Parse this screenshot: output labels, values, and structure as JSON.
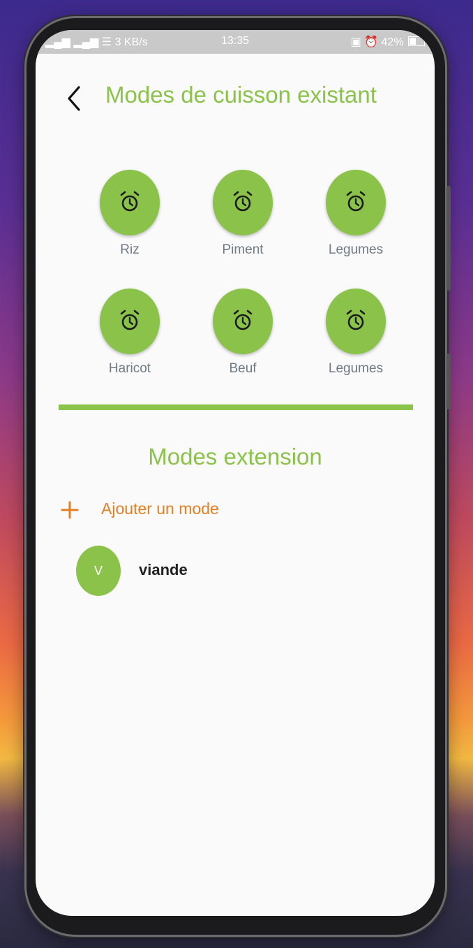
{
  "status_bar": {
    "signal": "▂▄▆ ▂▄▆ ☰ 3 KB/s",
    "time": "13:35",
    "battery": "42%"
  },
  "header": {
    "title": "Modes de cuisson existant",
    "back_icon": "chevron-left-icon"
  },
  "existing_modes": [
    {
      "label": "Riz",
      "icon": "alarm-clock-icon"
    },
    {
      "label": "Piment",
      "icon": "alarm-clock-icon"
    },
    {
      "label": "Legumes",
      "icon": "alarm-clock-icon"
    },
    {
      "label": "Haricot",
      "icon": "alarm-clock-icon"
    },
    {
      "label": "Beuf",
      "icon": "alarm-clock-icon"
    },
    {
      "label": "Legumes",
      "icon": "alarm-clock-icon"
    }
  ],
  "extension": {
    "title": "Modes extension",
    "add_label": "Ajouter un mode",
    "items": [
      {
        "initial": "V",
        "name": "viande"
      }
    ]
  },
  "colors": {
    "accent_green": "#8bc34a",
    "add_orange": "#e67e22",
    "label_gray": "#6f7a85"
  }
}
